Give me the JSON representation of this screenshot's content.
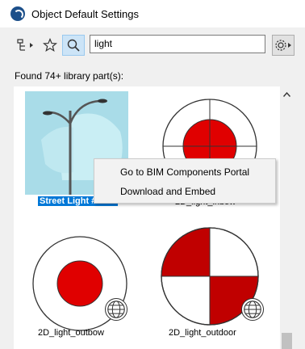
{
  "window": {
    "title": "Object Default Settings"
  },
  "toolbar": {
    "filter_icon": "filter-tree-icon",
    "favorites_icon": "star-icon",
    "search_icon": "search-icon",
    "search_value": "light",
    "settings_icon": "gear-icon"
  },
  "results": {
    "found_text": "Found 74+ library part(s):"
  },
  "items": [
    {
      "label": "Street Light #1510",
      "selected": true
    },
    {
      "label": "2D_light_inbow",
      "selected": false
    },
    {
      "label": "2D_light_outbow",
      "selected": false
    },
    {
      "label": "2D_light_outdoor",
      "selected": false
    }
  ],
  "context_menu": {
    "items": [
      {
        "label": "Go to BIM Components Portal"
      },
      {
        "label": "Download and Embed"
      }
    ]
  },
  "colors": {
    "accent_red": "#e00000",
    "dark_red": "#c00000",
    "selection_blue": "#0078d7"
  }
}
